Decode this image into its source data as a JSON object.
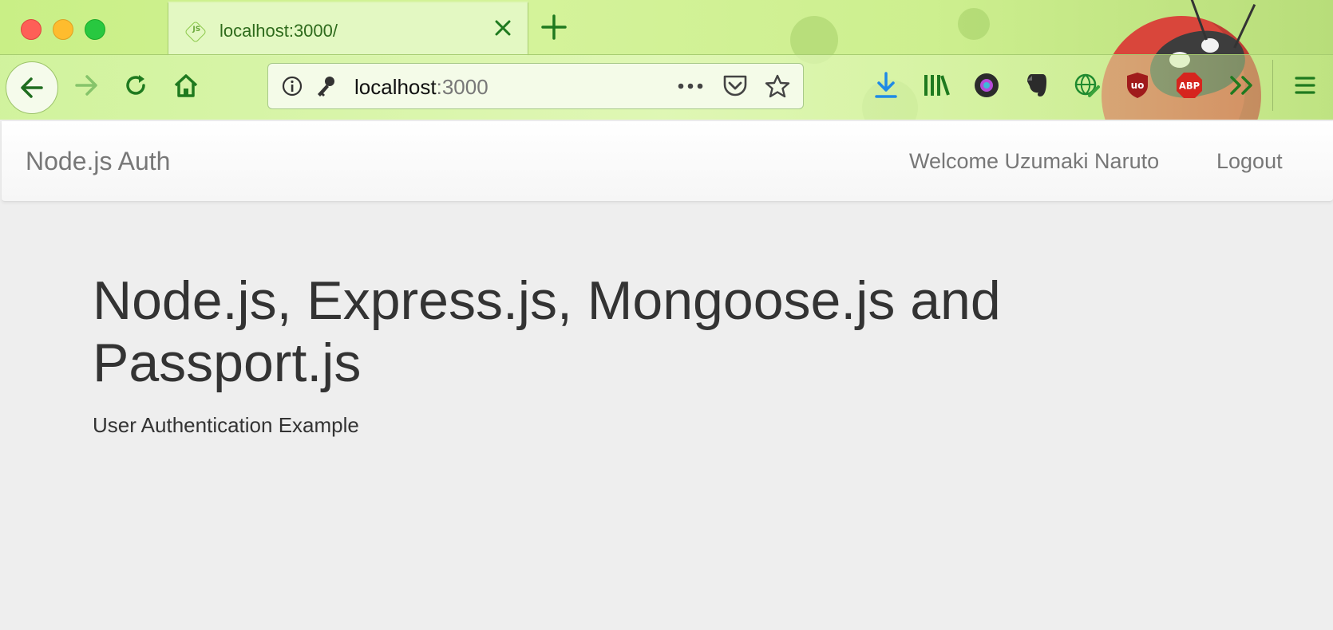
{
  "browser": {
    "tab": {
      "title": "localhost:3000/"
    },
    "url": {
      "host": "localhost",
      "port": ":3000"
    },
    "colors": {
      "chrome_green": "#c9ef86",
      "icon_green": "#1f7a1f",
      "download_blue": "#1e8ae6",
      "ublock_red": "#a01b1b",
      "abp_red": "#d6251e"
    },
    "icons": [
      "back-icon",
      "forward-icon",
      "reload-icon",
      "home-icon",
      "info-icon",
      "key-icon",
      "more-icon",
      "pocket-icon",
      "bookmark-star-icon",
      "download-icon",
      "library-icon",
      "camera-extension-icon",
      "evernote-icon",
      "globe-extension-icon",
      "ublock-icon",
      "abp-icon",
      "overflow-chevron-icon",
      "menu-icon"
    ],
    "abp_label": "ABP"
  },
  "app": {
    "brand": "Node.js Auth",
    "nav": {
      "welcome": "Welcome Uzumaki Naruto",
      "logout": "Logout"
    },
    "hero": {
      "title": "Node.js, Express.js, Mongoose.js and Passport.js",
      "subtitle": "User Authentication Example"
    }
  }
}
